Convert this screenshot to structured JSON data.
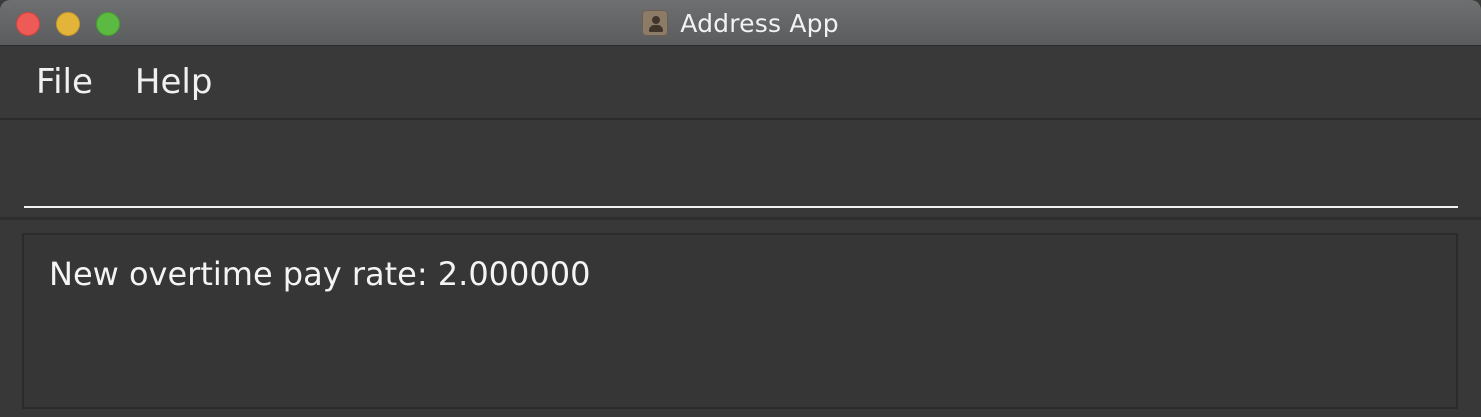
{
  "window": {
    "title": "Address App",
    "app_icon": "address-book-icon"
  },
  "menubar": {
    "items": [
      {
        "label": "File"
      },
      {
        "label": "Help"
      }
    ]
  },
  "command_box": {
    "value": "",
    "placeholder": ""
  },
  "result_display": {
    "text": "New overtime pay rate: 2.000000"
  },
  "colors": {
    "close": "#ee5b56",
    "minimize": "#e3b43a",
    "maximize": "#5cb942",
    "background": "#383838",
    "text": "#f2f2f2"
  }
}
